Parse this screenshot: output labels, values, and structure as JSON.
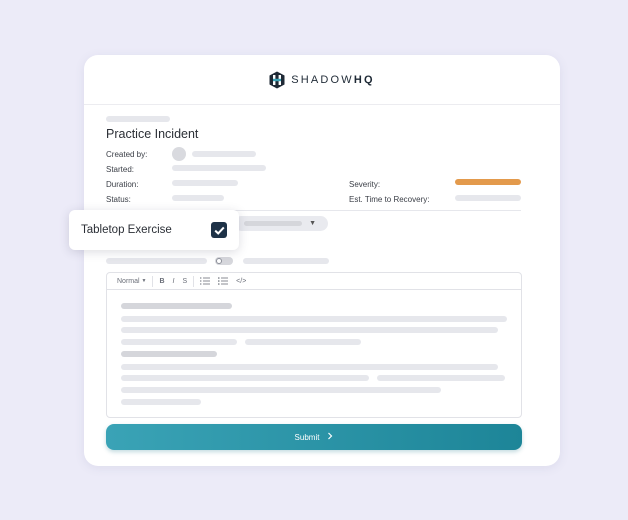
{
  "brand": {
    "prefix": "SHADOW",
    "suffix": "HQ"
  },
  "incident": {
    "title": "Practice Incident",
    "fields": {
      "created_by": "Created by:",
      "started": "Started:",
      "duration": "Duration:",
      "status": "Status:",
      "severity": "Severity:",
      "est_recovery": "Est. Time to Recovery:"
    }
  },
  "popover": {
    "label": "Tabletop Exercise",
    "checked": true
  },
  "editor": {
    "toolbar": {
      "format": "Normal",
      "bold": "B",
      "italic": "I",
      "strike": "S",
      "code": "</>"
    }
  },
  "submit": {
    "label": "Submit",
    "icon": "chevron-right-icon"
  },
  "colors": {
    "accent": "#1d8598",
    "severity": "#e39a4c",
    "checkbox": "#1e3247",
    "background": "#ecebf8"
  }
}
